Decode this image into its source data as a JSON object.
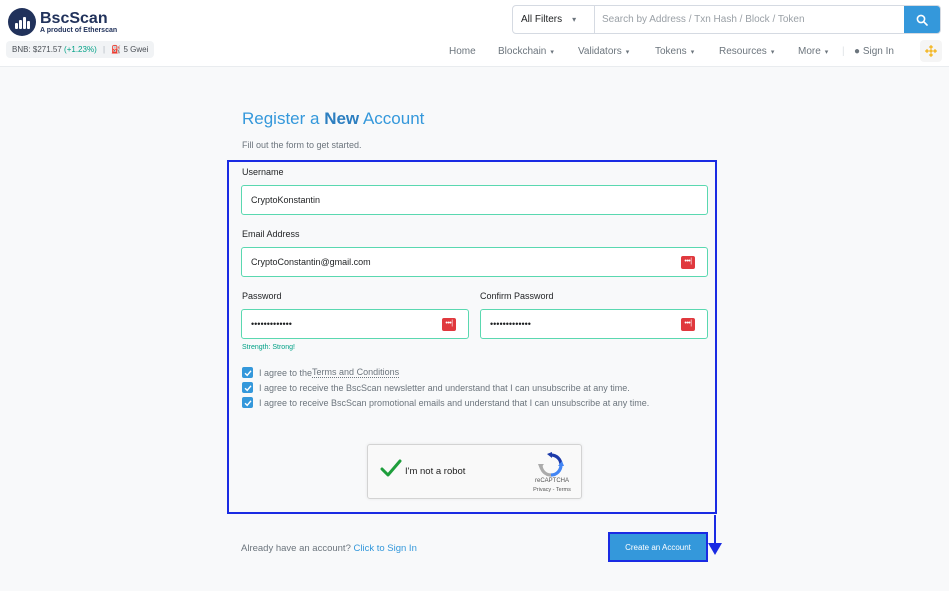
{
  "header": {
    "logo_title": "BscScan",
    "logo_subtitle": "A product of Etherscan",
    "price_label": "BNB: $271.57",
    "price_change": "(+1.23%)",
    "gas": "5 Gwei",
    "search": {
      "filter_label": "All Filters",
      "placeholder": "Search by Address / Txn Hash / Block / Token"
    },
    "nav": {
      "home": "Home",
      "blockchain": "Blockchain",
      "validators": "Validators",
      "tokens": "Tokens",
      "resources": "Resources",
      "more": "More",
      "sign_in": "Sign In"
    }
  },
  "form": {
    "title_pre": "Register a ",
    "title_bold": "New",
    "title_post": " Account",
    "subtitle": "Fill out the form to get started.",
    "username_label": "Username",
    "username_value": "CryptoKonstantin",
    "email_label": "Email Address",
    "email_value": "CryptoConstantin@gmail.com",
    "password_label": "Password",
    "password_value": "•••••••••••••",
    "confirm_label": "Confirm Password",
    "confirm_value": "•••••••••••••",
    "strength": "Strength: Strong!",
    "check_terms_pre": "I agree to the ",
    "check_terms_link": "Terms and Conditions",
    "check_newsletter": "I agree to receive the BscScan newsletter and understand that I can unsubscribe at any time.",
    "check_promo": "I agree to receive BscScan promotional emails and understand that I can unsubscribe at any time.",
    "recaptcha_label": "I'm not a robot",
    "recaptcha_brand": "reCAPTCHA",
    "recaptcha_terms": "Privacy - Terms",
    "already_text": "Already have an account? ",
    "sign_in_link": "Click to Sign In",
    "create_button": "Create an Account"
  },
  "colors": {
    "accent": "#3498db",
    "highlight": "#1a2be3",
    "success": "#00a186"
  }
}
